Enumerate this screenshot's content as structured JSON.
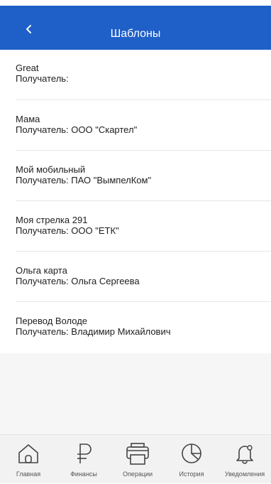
{
  "header": {
    "title": "Шаблоны",
    "back_icon": "chevron-left-icon"
  },
  "templates": [
    {
      "name": "Great",
      "recipient": "Получатель:"
    },
    {
      "name": "Мама",
      "recipient": "Получатель: ООО \"Скартел\""
    },
    {
      "name": "Мой мобильный",
      "recipient": "Получатель: ПАО \"ВымпелКом\""
    },
    {
      "name": "Моя стрелка 291",
      "recipient": "Получатель: ООО \"ЕТК\""
    },
    {
      "name": "Ольга  карта",
      "recipient": "Получатель: Ольга Сергеева"
    },
    {
      "name": "Перевод Володе",
      "recipient": "Получатель: Владимир Михайлович"
    }
  ],
  "tabbar": {
    "items": [
      {
        "label": "Главная",
        "icon": "home-icon"
      },
      {
        "label": "Финансы",
        "icon": "ruble-icon"
      },
      {
        "label": "Операции",
        "icon": "printer-icon"
      },
      {
        "label": "История",
        "icon": "pie-chart-icon"
      },
      {
        "label": "Уведомления",
        "icon": "bell-icon"
      }
    ]
  },
  "colors": {
    "header_bg": "#1f5fc8",
    "tabbar_bg": "#f2f2f2",
    "text": "#1d1d1d"
  }
}
